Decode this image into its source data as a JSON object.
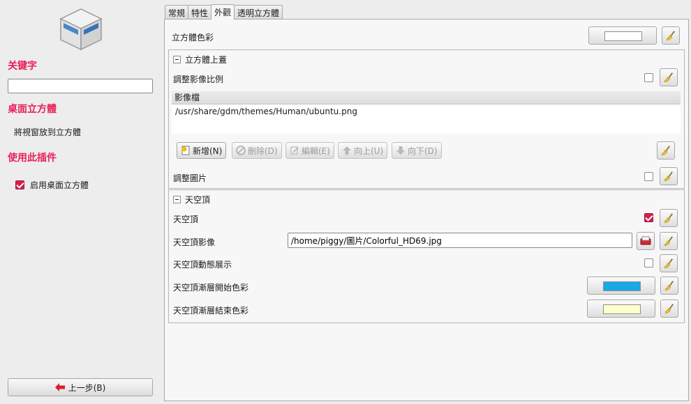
{
  "sidebar": {
    "keyword_title": "关键字",
    "search_value": "",
    "plugin_title": "桌面立方體",
    "plugin_desc": "將視窗放到立方體",
    "use_title": "使用此插件",
    "enable_label": "启用桌面立方體",
    "enable_checked": true,
    "back_label": "上一步(B)"
  },
  "tabs": [
    {
      "label": "常規",
      "active": false
    },
    {
      "label": "特性",
      "active": false
    },
    {
      "label": "外觀",
      "active": true
    },
    {
      "label": "透明立方體",
      "active": false
    }
  ],
  "main": {
    "cube_color_label": "立方體色彩",
    "cube_color": "#ffffff",
    "cap_group": {
      "title": "立方體上蓋",
      "scale_label": "調整影像比例",
      "scale_checked": false,
      "files_header": "影像檔",
      "files": [
        "/usr/share/gdm/themes/Human/ubuntu.png"
      ],
      "add_label": "新增(N)",
      "delete_label": "刪除(D)",
      "edit_label": "編輯(E)",
      "up_label": "向上(U)",
      "down_label": "向下(D)",
      "adjust_label": "調整圖片",
      "adjust_checked": false
    },
    "sky_group": {
      "title": "天空頂",
      "sky_label": "天空頂",
      "sky_checked": true,
      "image_label": "天空頂影像",
      "image_value": "/home/piggy/圖片/Colorful_HD69.jpg",
      "animate_label": "天空頂動態展示",
      "animate_checked": false,
      "grad_start_label": "天空頂漸層開始色彩",
      "grad_start_color": "#1aa8e6",
      "grad_end_label": "天空頂漸層結束色彩",
      "grad_end_color": "#ffffcc"
    }
  },
  "icons": {
    "reset": "broom-icon",
    "logo": "cube-icon",
    "back": "left-arrow-icon",
    "file_open": "open-file-icon"
  },
  "colors": {
    "accent": "#e8205a",
    "check": "#d71f4d"
  }
}
